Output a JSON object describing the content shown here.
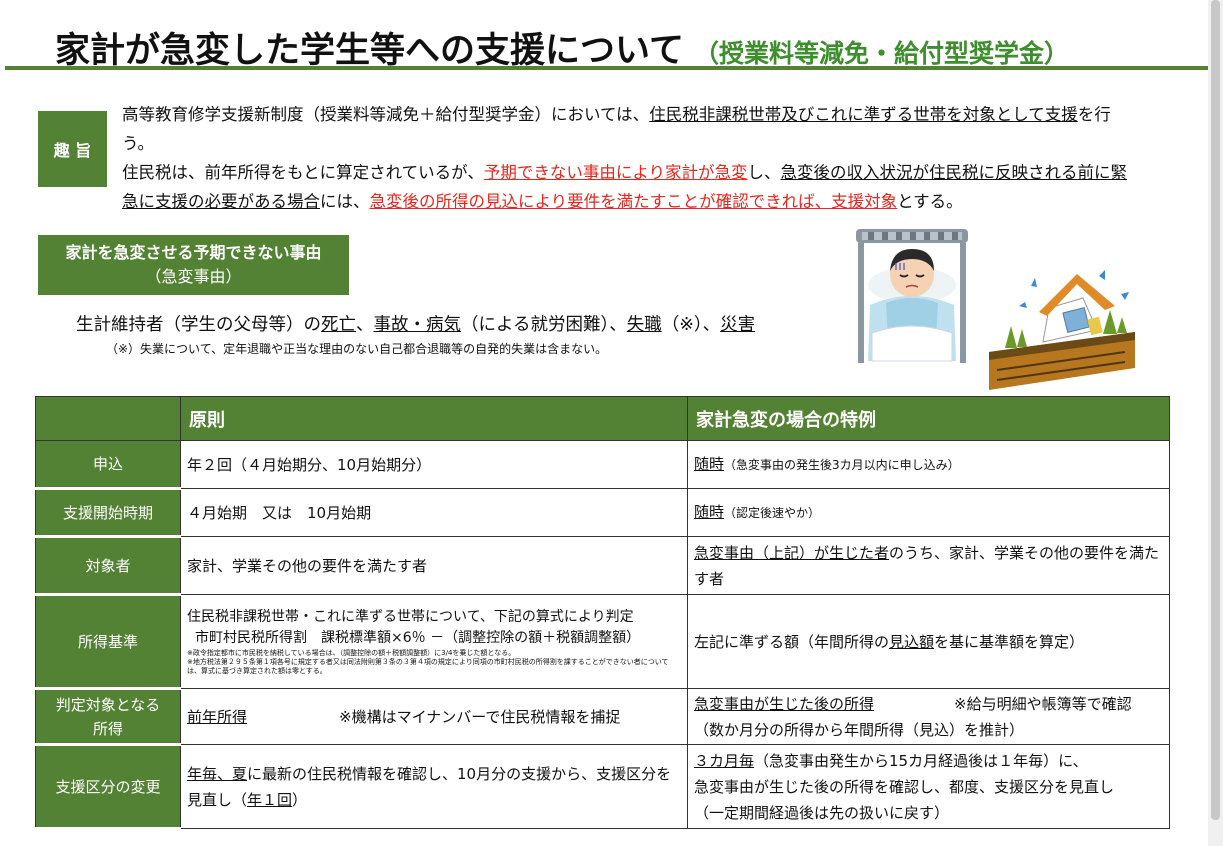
{
  "title": {
    "main": "家計が急変した学生等への支援について",
    "sub": "（授業料等減免・給付型奨学金）"
  },
  "summary": {
    "badge": "趣 旨",
    "p1_a": "高等教育修学支援新制度（授業料等減免＋給付型奨学金）においては、",
    "p1_u": "住民税非課税世帯及びこれに準ずる世帯を対象として支援",
    "p1_b": "を行う。",
    "p2_a": "住民税は、前年所得をもとに算定されているが、",
    "p2_red1": "予期できない事由により家計が急変",
    "p2_b": "し、",
    "p2_u": "急変後の収入状況が住民税に反映される前に緊急に支援の必要がある場合",
    "p2_c": "には、",
    "p2_red2": "急変後の所得の見込により要件を満たすことが確認できれば、支援対象",
    "p2_d": "とする。"
  },
  "cause": {
    "title": "家計を急変させる予期できない事由",
    "subtitle": "（急変事由）",
    "line_a": "生計維持者（学生の父母等）の",
    "death": "死亡",
    "sep1": "、",
    "accident": "事故・病気",
    "line_b": "（による就労困難）、",
    "job_loss": "失職",
    "line_c": "（※）、",
    "disaster": "災害",
    "note": "（※）失業について、定年退職や正当な理由のない自己都合退職等の自発的失業は含まない。"
  },
  "table": {
    "header": {
      "blank": "",
      "principle": "原則",
      "special": "家計急変の場合の特例"
    },
    "r1": {
      "label": "申込",
      "principle": "年２回（４月始期分、10月始期分）",
      "special_u": "随時",
      "special_small": "（急変事由の発生後3カ月以内に申し込み）"
    },
    "r2": {
      "label": "支援開始時期",
      "principle": "４月始期　又は　10月始期",
      "special_u": "随時",
      "special_small": "（認定後速やか）"
    },
    "r3": {
      "label": "対象者",
      "principle": "家計、学業その他の要件を満たす者",
      "special_u": "急変事由（上記）が生じた者",
      "special_b": "のうち、家計、学業その他の要件を満たす者"
    },
    "r4": {
      "label": "所得基準",
      "line1": "住民税非課税世帯・これに準ずる世帯について、下記の算式により判定",
      "line2": "市町村民税所得割　課税標準額×6％ －（調整控除の額＋税額調整額）",
      "note1": "※政令指定都市に市民税を納税している場合は、（調整控除の額＋税額調整額）に3/4を乗じた額となる。",
      "note2": "※地方税法第２９５条第１項各号に規定する者又は同法附則第３条の３第４項の規定により同項の市町村民税の所得割を課することができない者については、算式に基づき算定された額は零とする。",
      "special_a": "左記に準ずる額（年間所得の",
      "special_u": "見込額",
      "special_b": "を基に基準額を算定）"
    },
    "r5": {
      "label1": "判定対象となる",
      "label2": "所得",
      "principle_u": "前年所得",
      "principle_note": "※機構はマイナンバーで住民税情報を捕捉",
      "special_u": "急変事由が生じた後の所得",
      "special_note": "※給与明細や帳簿等で確認",
      "special_line2": "（数か月分の所得から年間所得（見込）を推計）"
    },
    "r6": {
      "label": "支援区分の変更",
      "principle_u1": "年毎、夏",
      "principle_a": "に最新の住民税情報を確認し、10月分の支援から、支援区分を見直し（",
      "principle_u2": "年１回",
      "principle_b": "）",
      "special_u": "３カ月毎",
      "special_a": "（急変事由発生から15カ月経過後は１年毎）に、",
      "special_line2": "急変事由が生じた後の所得を確認し、都度、支援区分を見直し",
      "special_line3": "（一定期間経過後は先の扱いに戻す）"
    }
  },
  "colors": {
    "accent_green": "#548235",
    "title_green": "#3c8f2c",
    "alert_red": "#e8261d"
  },
  "icons": [
    "sick-patient-icon",
    "disaster-house-icon"
  ]
}
